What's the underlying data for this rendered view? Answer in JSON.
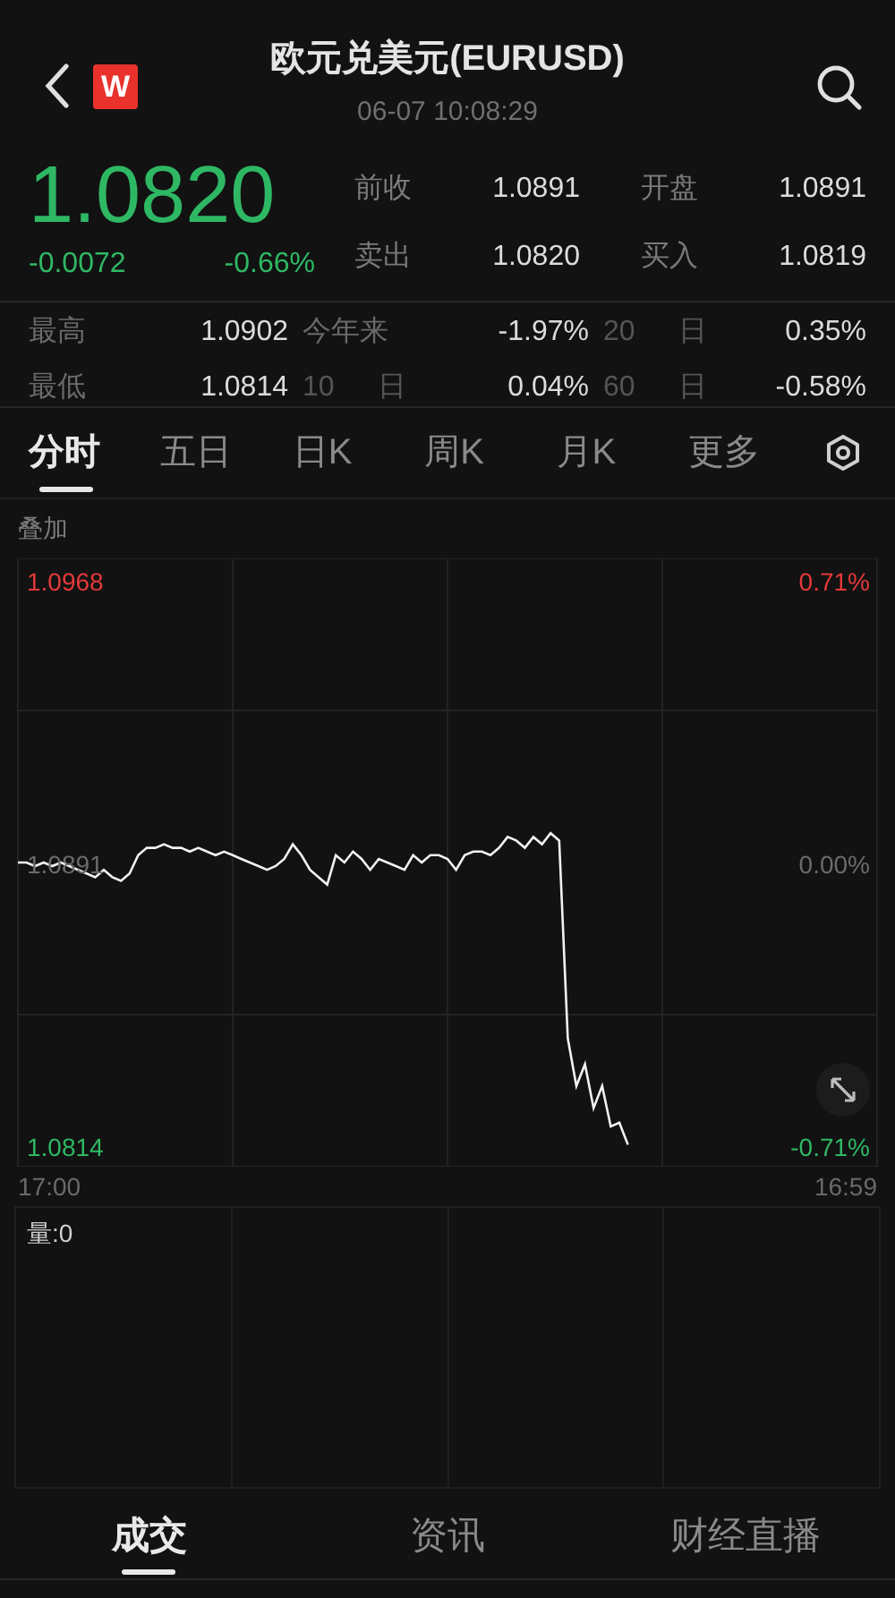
{
  "header": {
    "title": "欧元兑美元(EURUSD)",
    "time": "06-07 10:08:29",
    "logo": "W"
  },
  "quote": {
    "price": "1.0820",
    "change": "-0.0072",
    "change_pct": "-0.66%"
  },
  "stats": [
    {
      "label": "前收",
      "value": "1.0891"
    },
    {
      "label": "开盘",
      "value": "1.0891"
    },
    {
      "label": "卖出",
      "value": "1.0820"
    },
    {
      "label": "买入",
      "value": "1.0819"
    }
  ],
  "periods": [
    {
      "label": "最高",
      "value": "1.0902",
      "kind": "wide"
    },
    {
      "label": "今年来",
      "value": "-1.97%",
      "kind": "wide"
    },
    {
      "label": "20",
      "unit": "日",
      "value": "0.35%",
      "kind": "days"
    },
    {
      "label": "最低",
      "value": "1.0814",
      "kind": "wide"
    },
    {
      "label": "10",
      "unit": "日",
      "value": "0.04%",
      "kind": "days"
    },
    {
      "label": "60",
      "unit": "日",
      "value": "-0.58%",
      "kind": "days"
    }
  ],
  "chart_tabs": [
    {
      "label": "分时",
      "selected": true
    },
    {
      "label": "五日",
      "selected": false
    },
    {
      "label": "日K",
      "selected": false
    },
    {
      "label": "周K",
      "selected": false
    },
    {
      "label": "月K",
      "selected": false
    },
    {
      "label": "更多",
      "selected": false
    }
  ],
  "overlay_label": "叠加",
  "chart": {
    "levels": [
      {
        "price": "1.0968",
        "pct": "0.71%",
        "color": "#e5393a"
      },
      {
        "price": "1.0891",
        "pct": "0.00%",
        "color": "#6b6b6b"
      },
      {
        "price": "1.0814",
        "pct": "-0.71%",
        "color": "#2fb864"
      }
    ],
    "time_start": "17:00",
    "time_end": "16:59",
    "chart_data": {
      "type": "line",
      "ylim": [
        1.0808,
        1.0974
      ],
      "yticks": [
        1.0968,
        1.0891,
        1.0814
      ],
      "series": [
        {
          "color": "#f2f2f2",
          "values": [
            1.0891,
            1.0891,
            1.089,
            1.0891,
            1.089,
            1.0891,
            1.089,
            1.0889,
            1.0888,
            1.0887,
            1.0889,
            1.0887,
            1.0886,
            1.0888,
            1.0893,
            1.0895,
            1.0895,
            1.0896,
            1.0895,
            1.0895,
            1.0894,
            1.0895,
            1.0894,
            1.0893,
            1.0894,
            1.0893,
            1.0892,
            1.0891,
            1.089,
            1.0889,
            1.089,
            1.0892,
            1.0896,
            1.0893,
            1.0889,
            1.0887,
            1.0885,
            1.0893,
            1.0891,
            1.0894,
            1.0892,
            1.0889,
            1.0892,
            1.0891,
            1.089,
            1.0889,
            1.0893,
            1.0891,
            1.0893,
            1.0893,
            1.0892,
            1.0889,
            1.0893,
            1.0894,
            1.0894,
            1.0893,
            1.0895,
            1.0898,
            1.0897,
            1.0895,
            1.0898,
            1.0896,
            1.0899,
            1.0897,
            1.0843,
            1.083,
            1.0836,
            1.0824,
            1.083,
            1.0819,
            1.082,
            1.0814
          ]
        }
      ]
    }
  },
  "volume_label": "量:0",
  "bottom_tabs": [
    {
      "label": "成交",
      "selected": true
    },
    {
      "label": "资讯",
      "selected": false
    },
    {
      "label": "财经直播",
      "selected": false
    }
  ]
}
